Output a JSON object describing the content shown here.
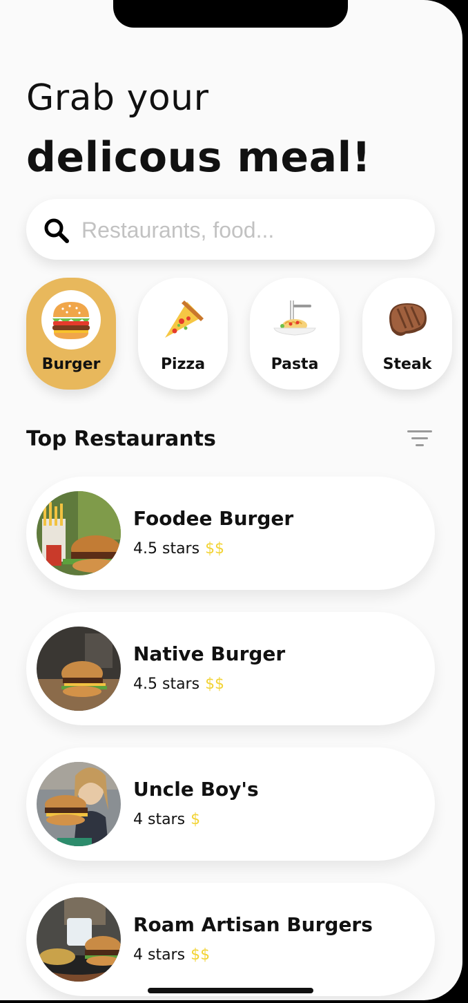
{
  "header": {
    "line1": "Grab your",
    "line2": "delicous meal!"
  },
  "search": {
    "placeholder": "Restaurants, food...",
    "value": ""
  },
  "categories": [
    {
      "label": "Burger",
      "icon": "burger-icon",
      "active": true
    },
    {
      "label": "Pizza",
      "icon": "pizza-icon",
      "active": false
    },
    {
      "label": "Pasta",
      "icon": "pasta-icon",
      "active": false
    },
    {
      "label": "Steak",
      "icon": "steak-icon",
      "active": false
    }
  ],
  "section": {
    "title": "Top Restaurants",
    "filter_icon": "filter-icon"
  },
  "restaurants": [
    {
      "name": "Foodee Burger",
      "rating": "4.5 stars",
      "price": "$$"
    },
    {
      "name": "Native Burger",
      "rating": "4.5 stars",
      "price": "$$"
    },
    {
      "name": "Uncle Boy's",
      "rating": "4 stars",
      "price": "$"
    },
    {
      "name": "Roam Artisan Burgers",
      "rating": "4 stars",
      "price": "$$"
    }
  ],
  "colors": {
    "accent": "#e8b85c",
    "price": "#f2d335",
    "background": "#fafafa",
    "card": "#ffffff"
  }
}
